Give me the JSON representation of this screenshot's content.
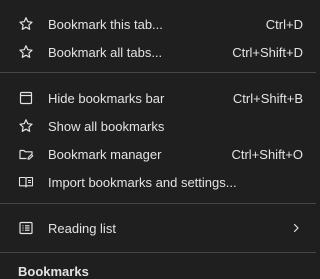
{
  "menu": {
    "items": [
      {
        "label": "Bookmark this tab...",
        "shortcut": "Ctrl+D",
        "icon": "star-outline-icon"
      },
      {
        "label": "Bookmark all tabs...",
        "shortcut": "Ctrl+Shift+D",
        "icon": "star-outline-icon"
      },
      {
        "label": "Hide bookmarks bar",
        "shortcut": "Ctrl+Shift+B",
        "icon": "bookmarks-bar-icon"
      },
      {
        "label": "Show all bookmarks",
        "shortcut": "",
        "icon": "star-outline-icon"
      },
      {
        "label": "Bookmark manager",
        "shortcut": "Ctrl+Shift+O",
        "icon": "folder-edit-icon"
      },
      {
        "label": "Import bookmarks and settings...",
        "shortcut": "",
        "icon": "import-book-icon"
      },
      {
        "label": "Reading list",
        "shortcut": "",
        "icon": "reading-list-icon",
        "submenu": "chevron-right-icon"
      }
    ],
    "section_peek": "Bookmarks"
  },
  "colors": {
    "background": "#1f1f1f",
    "text": "#e3e3e3",
    "separator": "#474747"
  }
}
